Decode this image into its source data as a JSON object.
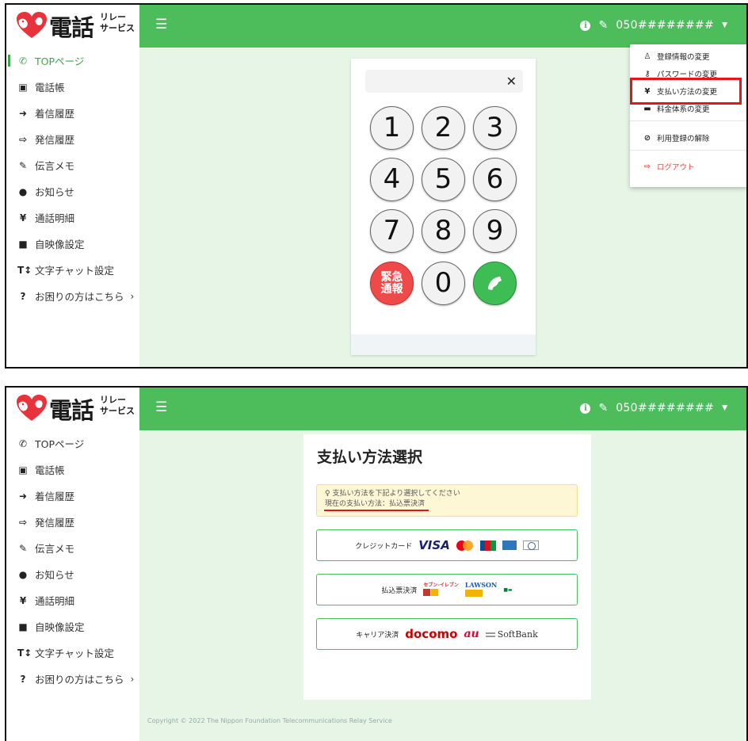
{
  "brand": {
    "main": "電話",
    "sub_line1": "リレー",
    "sub_line2": "サービス"
  },
  "account": {
    "phone": "050########"
  },
  "sidebar": {
    "items": [
      {
        "label": "TOPページ",
        "icon": "phone-icon"
      },
      {
        "label": "電話帳",
        "icon": "address-book-icon"
      },
      {
        "label": "着信履歴",
        "icon": "sign-in-icon"
      },
      {
        "label": "発信履歴",
        "icon": "sign-out-icon"
      },
      {
        "label": "伝言メモ",
        "icon": "edit-icon"
      },
      {
        "label": "お知らせ",
        "icon": "info-icon"
      },
      {
        "label": "通話明細",
        "icon": "yen-icon"
      },
      {
        "label": "自映像設定",
        "icon": "video-icon"
      },
      {
        "label": "文字チャット設定",
        "icon": "text-height-icon"
      },
      {
        "label": "お困りの方はこちら",
        "icon": "question-circle-icon"
      }
    ]
  },
  "dialpad": {
    "keys": [
      "1",
      "2",
      "3",
      "4",
      "5",
      "6",
      "7",
      "8",
      "9"
    ],
    "emergency_line1": "緊急",
    "emergency_line2": "通報",
    "zero": "0"
  },
  "dropdown": {
    "items": [
      {
        "label": "登録情報の変更",
        "icon": "user-icon"
      },
      {
        "label": "パスワードの変更",
        "icon": "key-icon"
      },
      {
        "label": "支払い方法の変更",
        "icon": "yen-icon"
      },
      {
        "label": "料金体系の変更",
        "icon": "wallet-icon"
      },
      {
        "label": "利用登録の解除",
        "icon": "user-slash-icon"
      },
      {
        "label": "ログアウト",
        "icon": "sign-out-icon"
      }
    ]
  },
  "payment": {
    "title": "支払い方法選択",
    "notice_line1": "支払い方法を下記より選択してください",
    "notice_line2": "現在の支払い方法：払込票決済",
    "options": [
      {
        "label": "クレジットカード",
        "brands": [
          "VISA"
        ]
      },
      {
        "label": "払込票決済",
        "brands": [
          "セブン-イレブン",
          "LAWSON"
        ]
      },
      {
        "label": "キャリア決済",
        "brands": [
          "docomo",
          "au",
          "SoftBank"
        ]
      }
    ]
  },
  "footer": {
    "copyright": "Copyright © 2022 The Nippon Foundation Telecommunications Relay Service"
  },
  "colors": {
    "brand_green": "#4cbd5a",
    "content_bg": "#e6f5e6",
    "emergency_red": "#ef4a4a",
    "call_green": "#3ebd55",
    "highlight_red": "#e8141a"
  }
}
